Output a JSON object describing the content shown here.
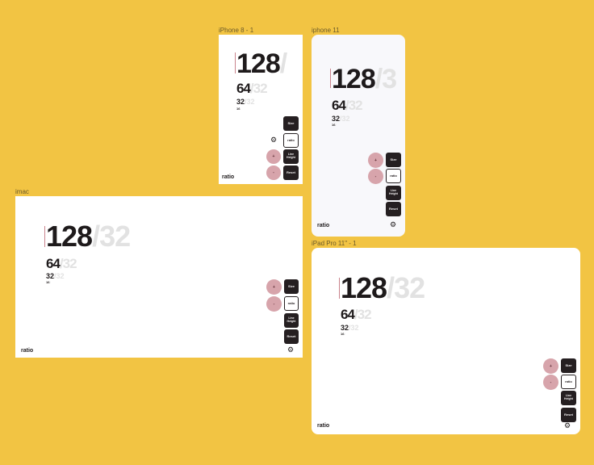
{
  "frames": {
    "iphone8": {
      "label": "iPhone 8 - 1"
    },
    "iphone11": {
      "label": "iphone 11"
    },
    "imac": {
      "label": "imac"
    },
    "ipad": {
      "label": "iPad Pro 11\" - 1"
    }
  },
  "type_scale": {
    "h1": "128",
    "h1_ratio": "/",
    "h1_ratio_iphone11": "/3",
    "h1_ratio_full": "/32",
    "h2": "64",
    "h2_ratio": "/32",
    "h3": "32",
    "h3_ratio": "/32",
    "h4": "16",
    "h4_ratio": "/"
  },
  "controls": {
    "size": "Size",
    "ratio": "ratio",
    "line_height": "Line Height",
    "reset": "Reset",
    "plus": "+",
    "minus": "-"
  },
  "brand": "ratio",
  "icons": {
    "settings": "gear-icon"
  },
  "colors": {
    "background": "#f2c443",
    "dark": "#251f21",
    "accent": "#d7a4ab",
    "muted": "#e2e2e2"
  }
}
